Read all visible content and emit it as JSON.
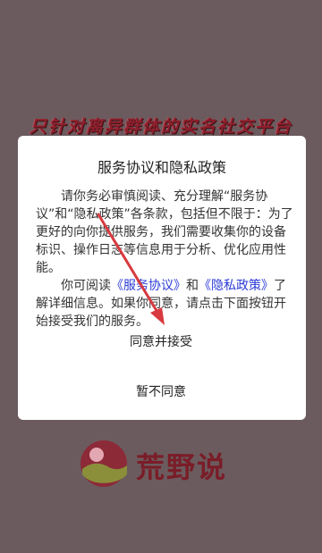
{
  "background": {
    "tagline": "只针对离异群体的实名社交平台",
    "brand_name": "荒野说"
  },
  "dialog": {
    "title": "服务协议和隐私政策",
    "para1": "请你务必审慎阅读、充分理解“服务协议”和“隐私政策”各条款，包括但不限于：为了更好的向你提供服务，我们需要收集你的设备标识、操作日志等信息用于分析、优化应用性能。",
    "para2_prefix": "你可阅读",
    "service_link": "《服务协议》",
    "para2_and": "和",
    "privacy_link": "《隐私政策》",
    "para2_suffix": "了解详细信息。如果你同意，请点击下面按钮开始接受我们的服务。",
    "agree_label": "同意并接受",
    "disagree_label": "暂不同意"
  },
  "colors": {
    "background": "#6b5b5e",
    "link": "#2b3bd6",
    "arrow": "#d83a3f",
    "brand": "#7a1d28"
  }
}
